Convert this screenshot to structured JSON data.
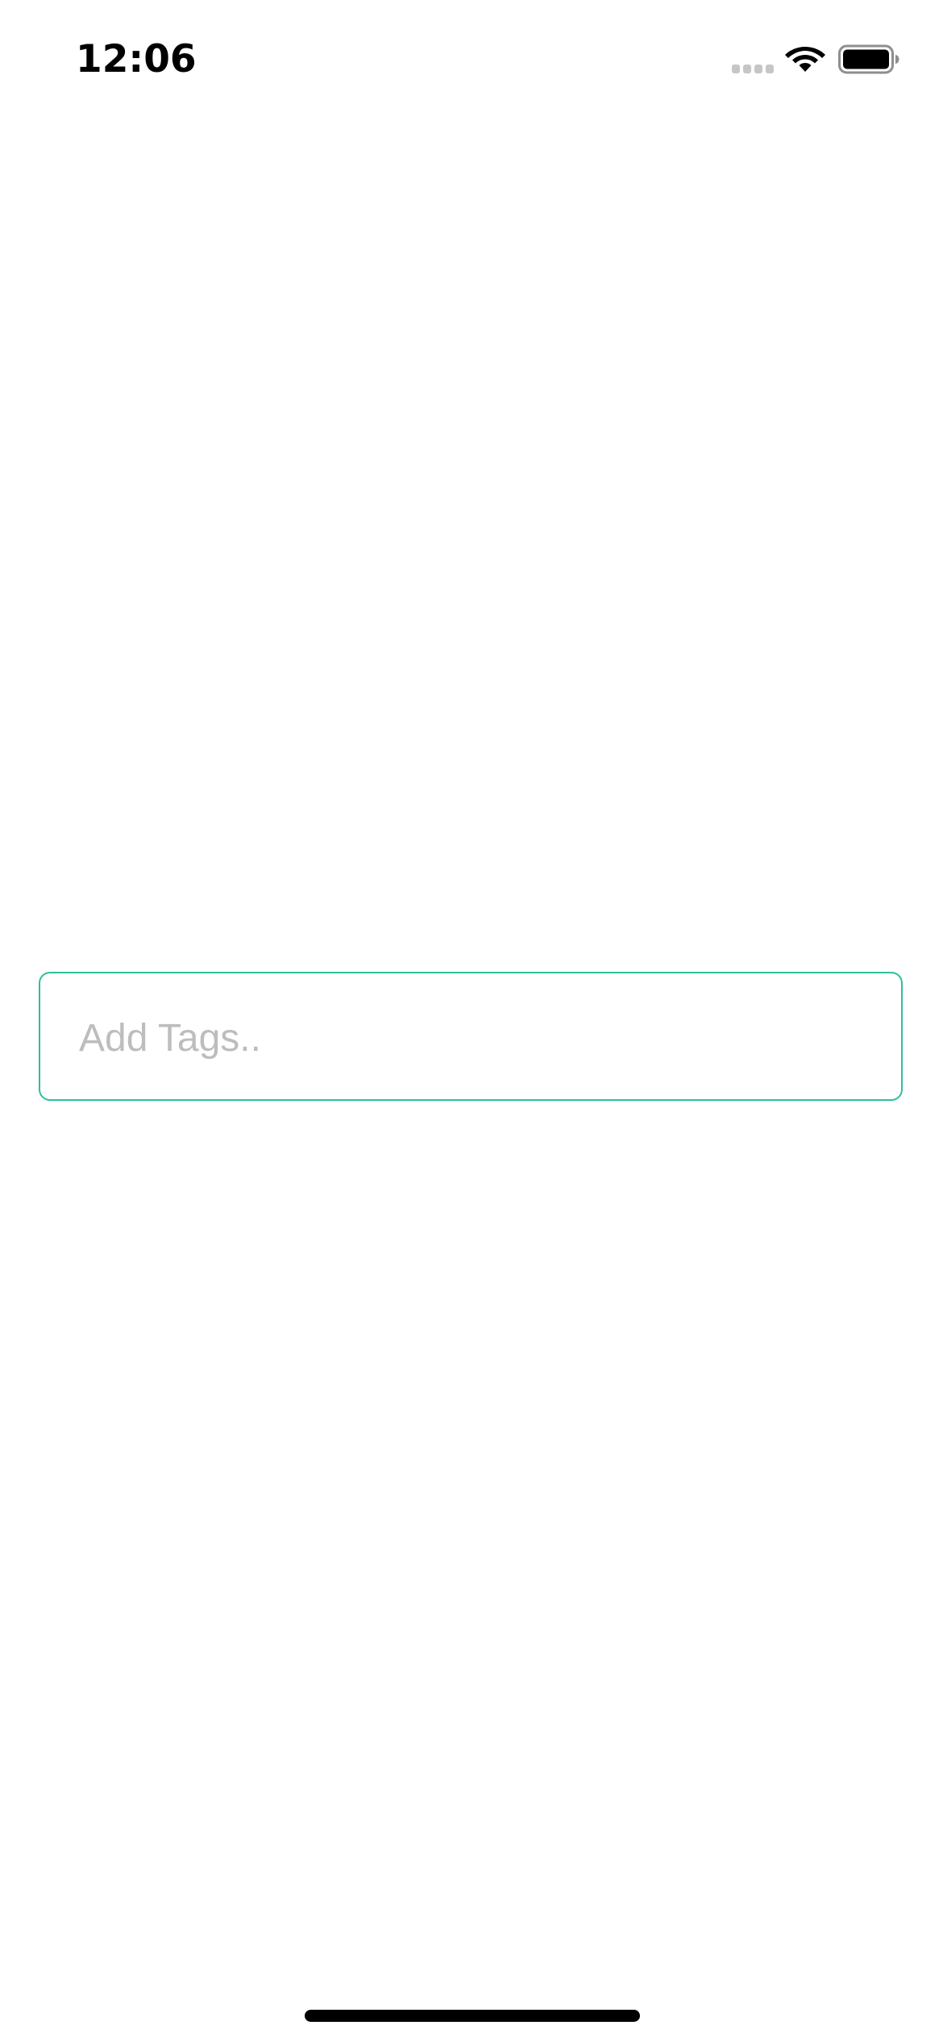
{
  "status_bar": {
    "time": "12:06",
    "signal_icon": "signal-bars-icon",
    "wifi_icon": "wifi-icon",
    "battery_icon": "battery-icon"
  },
  "tag_input": {
    "value": "",
    "placeholder": "Add Tags.."
  },
  "colors": {
    "accent_border": "#2fbf9b",
    "placeholder": "#bdbdbd",
    "background": "#ffffff"
  }
}
